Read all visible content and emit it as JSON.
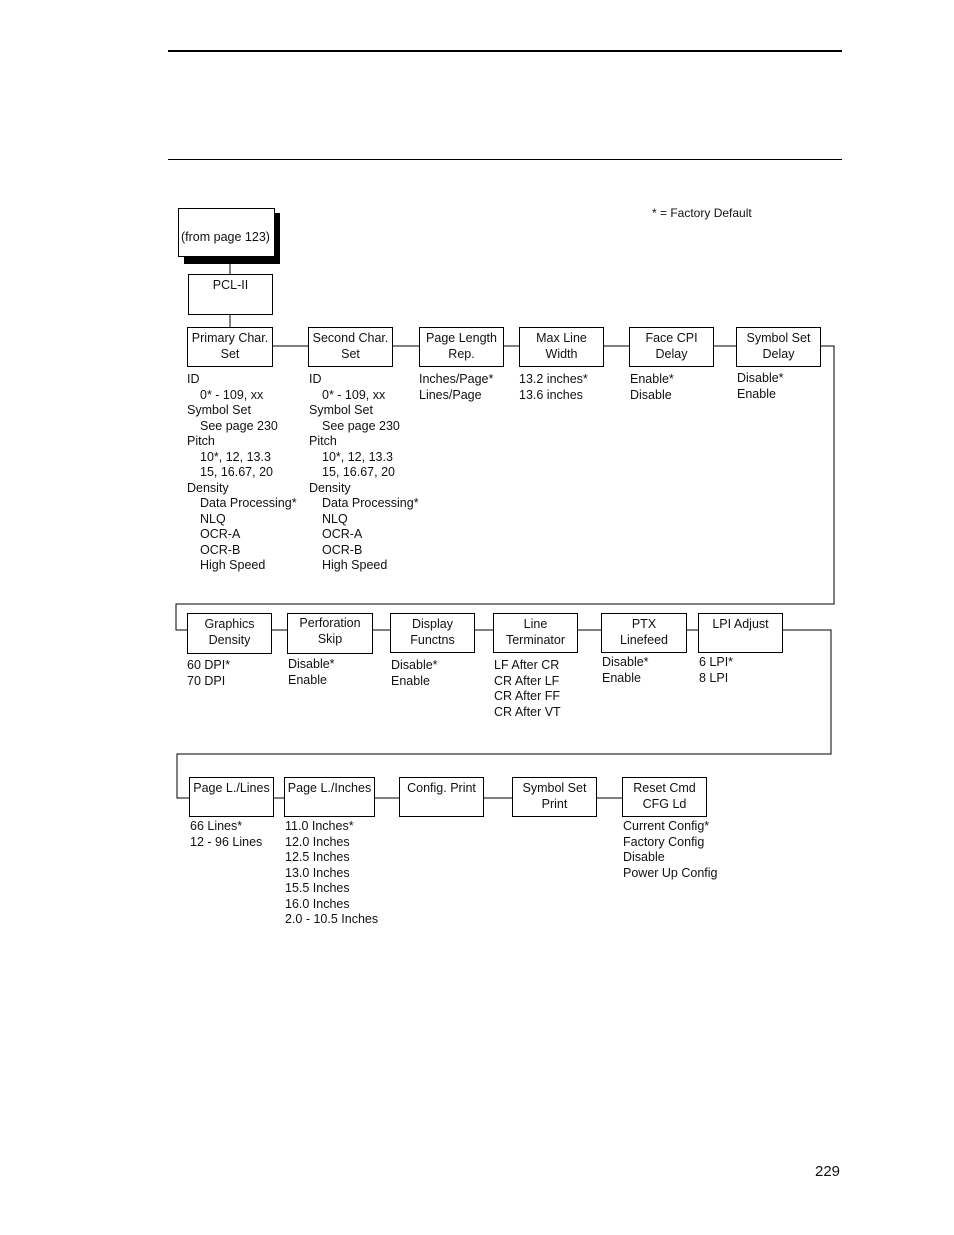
{
  "legend": "* = Factory Default",
  "page_number": "229",
  "entry": {
    "label": "(from page 123)"
  },
  "root": {
    "label": "PCL-II"
  },
  "rows": [
    {
      "items": [
        {
          "title": [
            "Primary Char.",
            "Set"
          ],
          "options": [
            {
              "text": "ID",
              "indent": false
            },
            {
              "text": "0* - 109, xx",
              "indent": true
            },
            {
              "text": "Symbol Set",
              "indent": false
            },
            {
              "text": "See page 230",
              "indent": true
            },
            {
              "text": "Pitch",
              "indent": false
            },
            {
              "text": "10*, 12, 13.3",
              "indent": true
            },
            {
              "text": "15, 16.67, 20",
              "indent": true
            },
            {
              "text": "Density",
              "indent": false
            },
            {
              "text": "Data Processing*",
              "indent": true
            },
            {
              "text": "NLQ",
              "indent": true
            },
            {
              "text": "OCR-A",
              "indent": true
            },
            {
              "text": "OCR-B",
              "indent": true
            },
            {
              "text": "High Speed",
              "indent": true
            }
          ]
        },
        {
          "title": [
            "Second Char.",
            "Set"
          ],
          "options": [
            {
              "text": "ID",
              "indent": false
            },
            {
              "text": "0* - 109, xx",
              "indent": true
            },
            {
              "text": "Symbol Set",
              "indent": false
            },
            {
              "text": "See page 230",
              "indent": true
            },
            {
              "text": "Pitch",
              "indent": false
            },
            {
              "text": "10*, 12, 13.3",
              "indent": true
            },
            {
              "text": "15, 16.67, 20",
              "indent": true
            },
            {
              "text": "Density",
              "indent": false
            },
            {
              "text": "Data Processing*",
              "indent": true
            },
            {
              "text": "NLQ",
              "indent": true
            },
            {
              "text": "OCR-A",
              "indent": true
            },
            {
              "text": "OCR-B",
              "indent": true
            },
            {
              "text": "High Speed",
              "indent": true
            }
          ]
        },
        {
          "title": [
            "Page Length",
            "Rep."
          ],
          "options": [
            {
              "text": "Inches/Page*"
            },
            {
              "text": "Lines/Page"
            }
          ]
        },
        {
          "title": [
            "Max Line",
            "Width"
          ],
          "options": [
            {
              "text": "13.2 inches*"
            },
            {
              "text": "13.6 inches"
            }
          ]
        },
        {
          "title": [
            "Face CPI",
            "Delay"
          ],
          "options": [
            {
              "text": "Enable*"
            },
            {
              "text": "Disable"
            }
          ]
        },
        {
          "title": [
            "Symbol Set",
            "Delay"
          ],
          "options": [
            {
              "text": "Disable*"
            },
            {
              "text": "Enable"
            }
          ]
        }
      ]
    },
    {
      "items": [
        {
          "title": [
            "Graphics",
            "Density"
          ],
          "options": [
            {
              "text": "60 DPI*"
            },
            {
              "text": "70 DPI"
            }
          ]
        },
        {
          "title": [
            "Perforation",
            "Skip"
          ],
          "options": [
            {
              "text": "Disable*"
            },
            {
              "text": "Enable"
            }
          ]
        },
        {
          "title": [
            "Display",
            "Functns"
          ],
          "options": [
            {
              "text": "Disable*"
            },
            {
              "text": "Enable"
            }
          ]
        },
        {
          "title": [
            "Line",
            "Terminator"
          ],
          "options": [
            {
              "text": "LF After CR"
            },
            {
              "text": "CR After LF"
            },
            {
              "text": "CR After FF"
            },
            {
              "text": "CR After VT"
            }
          ]
        },
        {
          "title": [
            "PTX",
            "Linefeed"
          ],
          "options": [
            {
              "text": "Disable*"
            },
            {
              "text": "Enable"
            }
          ]
        },
        {
          "title": [
            "LPI Adjust"
          ],
          "options": [
            {
              "text": "6 LPI*"
            },
            {
              "text": "8 LPI"
            }
          ]
        }
      ]
    },
    {
      "items": [
        {
          "title": [
            "Page L./Lines"
          ],
          "options": [
            {
              "text": "66 Lines*"
            },
            {
              "text": "12 - 96 Lines"
            }
          ]
        },
        {
          "title": [
            "Page L./Inches"
          ],
          "options": [
            {
              "text": "11.0 Inches*"
            },
            {
              "text": "12.0 Inches"
            },
            {
              "text": "12.5 Inches"
            },
            {
              "text": "13.0 Inches"
            },
            {
              "text": "15.5 Inches"
            },
            {
              "text": "16.0 Inches"
            },
            {
              "text": "2.0 - 10.5 Inches"
            }
          ]
        },
        {
          "title": [
            "Config. Print"
          ],
          "options": []
        },
        {
          "title": [
            "Symbol Set",
            "Print"
          ],
          "options": []
        },
        {
          "title": [
            "Reset Cmd",
            "CFG Ld"
          ],
          "options": [
            {
              "text": "Current Config*"
            },
            {
              "text": "Factory Config"
            },
            {
              "text": "Disable"
            },
            {
              "text": "Power Up Config"
            }
          ]
        }
      ]
    }
  ]
}
